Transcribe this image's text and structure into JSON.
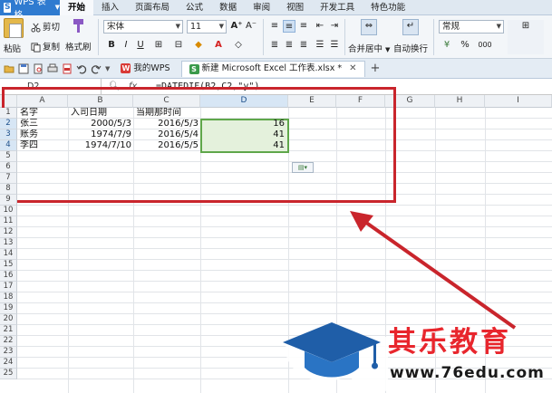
{
  "menubar": {
    "app_label": "WPS 表格",
    "tabs": [
      "开始",
      "插入",
      "页面布局",
      "公式",
      "数据",
      "审阅",
      "视图",
      "开发工具",
      "特色功能"
    ],
    "active_tab": "开始"
  },
  "ribbon": {
    "paste": "粘贴",
    "cut": "剪切",
    "copy": "复制",
    "format_painter": "格式刷",
    "font_name": "宋体",
    "font_size": "11",
    "merge_center": "合并居中",
    "wrap_text": "自动换行",
    "number_format": "常规",
    "percent": "%",
    "thousands": "000"
  },
  "tabbar": {
    "tabs": [
      {
        "label": "我的WPS"
      },
      {
        "label": "新建 Microsoft Excel 工作表.xlsx *"
      }
    ],
    "add": "+"
  },
  "formula_bar": {
    "name_box": "D2",
    "fx": "fx",
    "formula": "=DATEDIF(B2,C2,\"y\")"
  },
  "sheet": {
    "columns": [
      "A",
      "B",
      "C",
      "D",
      "E",
      "F",
      "G",
      "H",
      "I"
    ],
    "row_numbers": [
      "1",
      "2",
      "3",
      "4",
      "5",
      "6",
      "7",
      "8",
      "9",
      "10",
      "11",
      "12",
      "13",
      "14",
      "15",
      "16",
      "17",
      "18",
      "19",
      "20",
      "21",
      "22",
      "23",
      "24",
      "25"
    ],
    "cells": {
      "A1": "名字",
      "B1": "入司日期",
      "C1": "当期那时间",
      "A2": "张三",
      "B2": "2000/5/3",
      "C2": "2016/5/3",
      "D2": "16",
      "A3": "账务",
      "B3": "1974/7/9",
      "C3": "2016/5/4",
      "D3": "41",
      "A4": "李四",
      "B4": "1974/7/10",
      "C4": "2016/5/5",
      "D4": "41"
    }
  },
  "watermark": {
    "brand": "其乐教育",
    "url": "www.76edu.com"
  }
}
